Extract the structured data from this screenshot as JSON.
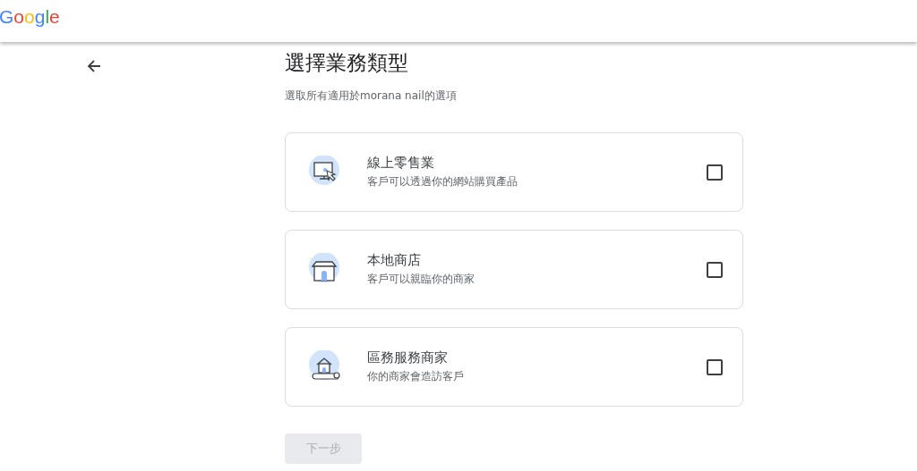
{
  "header": {
    "logo": "Google"
  },
  "title": "選擇業務類型",
  "subtitle": "選取所有適用於morana nail的選項",
  "options": [
    {
      "kind": "monitor",
      "title": "線上零售業",
      "description": "客戶可以透過你的網站購買產品",
      "checked": false
    },
    {
      "kind": "store",
      "title": "本地商店",
      "description": "客戶可以親臨你的商家",
      "checked": false
    },
    {
      "kind": "house",
      "title": "區務服務商家",
      "description": "你的商家會造訪客戶",
      "checked": false
    }
  ],
  "next_button": {
    "label": "下一步",
    "disabled": true
  }
}
